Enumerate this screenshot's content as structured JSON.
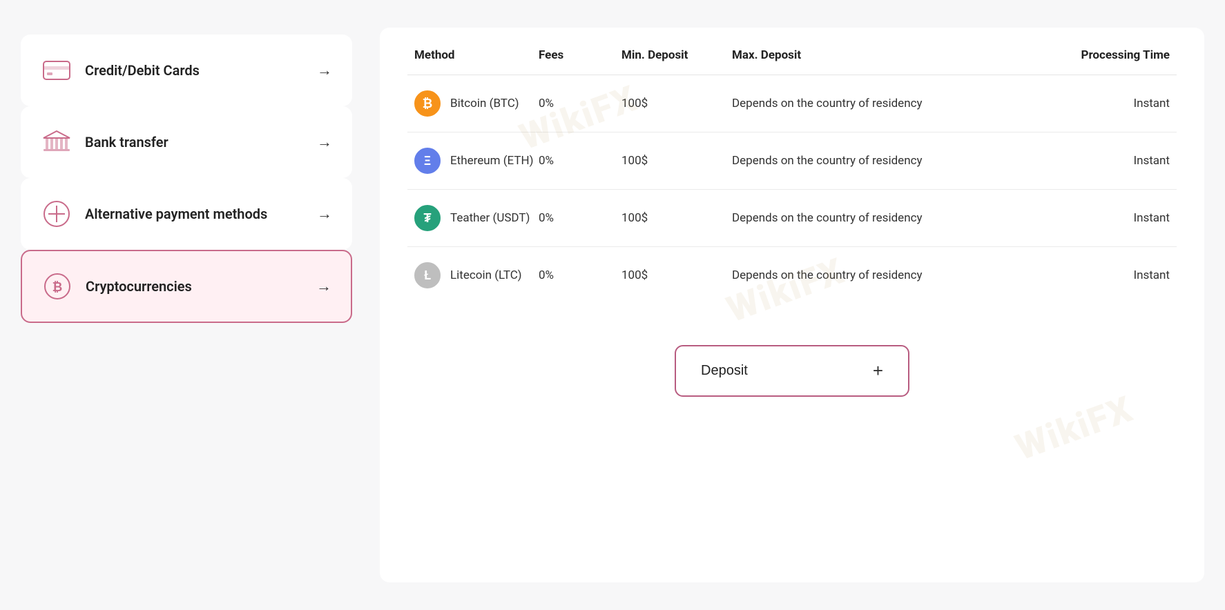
{
  "left": {
    "items": [
      {
        "id": "credit-debit",
        "label": "Credit/Debit Cards",
        "active": false,
        "icon": "card-icon"
      },
      {
        "id": "bank-transfer",
        "label": "Bank transfer",
        "active": false,
        "icon": "bank-icon"
      },
      {
        "id": "alternative",
        "label": "Alternative payment methods",
        "active": false,
        "icon": "alt-icon"
      },
      {
        "id": "cryptocurrencies",
        "label": "Cryptocurrencies",
        "active": true,
        "icon": "crypto-icon"
      }
    ]
  },
  "right": {
    "table": {
      "headers": [
        "Method",
        "Fees",
        "Min. Deposit",
        "Max. Deposit",
        "Processing Time"
      ],
      "rows": [
        {
          "method": "Bitcoin (BTC)",
          "coinColor": "#f7931a",
          "coinLabel": "₿",
          "fees": "0%",
          "minDeposit": "100$",
          "maxDeposit": "Depends on the country of residency",
          "processingTime": "Instant"
        },
        {
          "method": "Ethereum (ETH)",
          "coinColor": "#627eea",
          "coinLabel": "Ξ",
          "fees": "0%",
          "minDeposit": "100$",
          "maxDeposit": "Depends on the country of residency",
          "processingTime": "Instant"
        },
        {
          "method": "Teather (USDT)",
          "coinColor": "#26a17b",
          "coinLabel": "₮",
          "fees": "0%",
          "minDeposit": "100$",
          "maxDeposit": "Depends on the country of residency",
          "processingTime": "Instant"
        },
        {
          "method": "Litecoin (LTC)",
          "coinColor": "#bebebe",
          "coinLabel": "Ł",
          "fees": "0%",
          "minDeposit": "100$",
          "maxDeposit": "Depends on the country of residency",
          "processingTime": "Instant"
        }
      ]
    },
    "depositButton": {
      "label": "Deposit",
      "plus": "+"
    }
  },
  "watermark": {
    "text": "WikiFX"
  }
}
